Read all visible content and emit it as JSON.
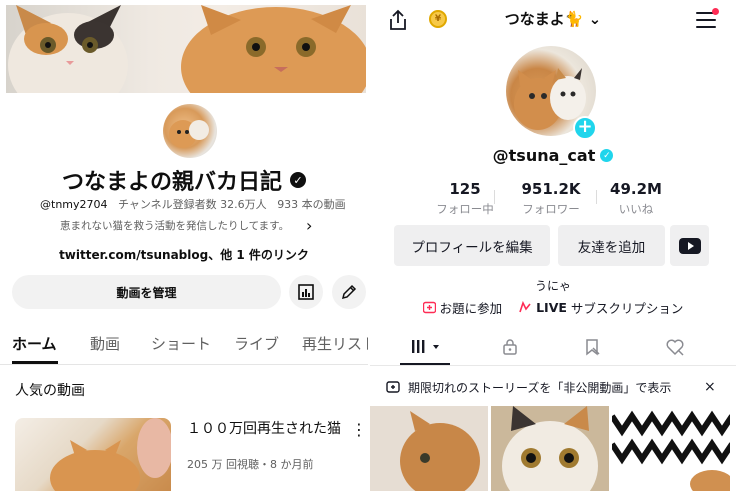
{
  "youtube": {
    "channel_name": "つなまよの親バカ日記",
    "handle": "@tnmy2704",
    "subscribers": "チャンネル登録者数 32.6万人",
    "video_count": "933 本の動画",
    "description": "恵まれない猫を救う活動を発信したりしてます。",
    "link": "twitter.com/tsunablog、他 1 件のリンク",
    "manage_button": "動画を管理",
    "tabs": [
      "ホーム",
      "動画",
      "ショート",
      "ライブ",
      "再生リスト"
    ],
    "section_title": "人気の動画",
    "video": {
      "title": "１００万回再生された猫",
      "meta": "205 万 回視聴・8 か月前"
    }
  },
  "tiktok": {
    "name": "つなまよ🐈",
    "handle": "@tsuna_cat",
    "stats": [
      {
        "value": "125",
        "label": "フォロー中"
      },
      {
        "value": "951.2K",
        "label": "フォロワー"
      },
      {
        "value": "49.2M",
        "label": "いいね"
      }
    ],
    "edit_profile": "プロフィールを編集",
    "add_friends": "友達を追加",
    "bio": "うにゃ",
    "topic_link": "お題に参加",
    "live_bold": "LIVE",
    "live_rest": "サブスクリプション",
    "story_banner": "期限切れのストーリーズを「非公開動画」で表示",
    "colors": {
      "accent": "#20d5ec",
      "notification": "#fe2c55",
      "live": "#fe2c55"
    }
  }
}
